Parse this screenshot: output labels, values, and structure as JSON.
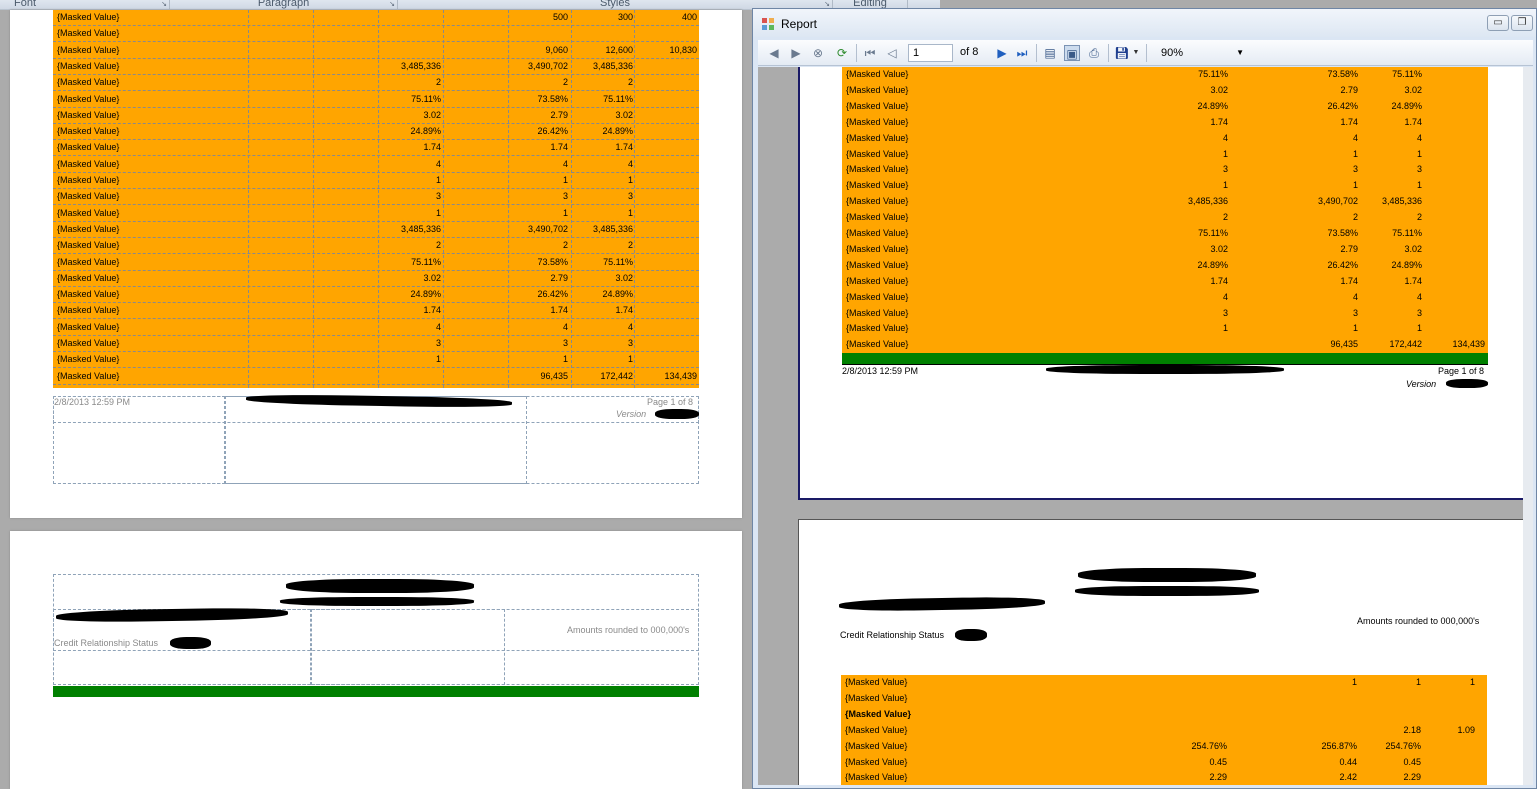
{
  "ribbon": {
    "groups": [
      "Font",
      "Paragraph",
      "Styles",
      "Editing"
    ]
  },
  "doc_page1": {
    "rows": [
      {
        "label": "{Masked Value}",
        "c1": "",
        "c2": "500",
        "c3": "300",
        "c4": "400"
      },
      {
        "label": "{Masked Value}",
        "c1": "",
        "c2": "",
        "c3": "",
        "c4": ""
      },
      {
        "label": "{Masked Value}",
        "c1": "",
        "c2": "9,060",
        "c3": "12,600",
        "c4": "10,830"
      },
      {
        "label": "{Masked Value}",
        "c1": "3,485,336",
        "c2": "3,490,702",
        "c3": "3,485,336",
        "c4": ""
      },
      {
        "label": "{Masked Value}",
        "c1": "2",
        "c2": "2",
        "c3": "2",
        "c4": ""
      },
      {
        "label": "{Masked Value}",
        "c1": "75.11%",
        "c2": "73.58%",
        "c3": "75.11%",
        "c4": ""
      },
      {
        "label": "{Masked Value}",
        "c1": "3.02",
        "c2": "2.79",
        "c3": "3.02",
        "c4": ""
      },
      {
        "label": "{Masked Value}",
        "c1": "24.89%",
        "c2": "26.42%",
        "c3": "24.89%",
        "c4": ""
      },
      {
        "label": "{Masked Value}",
        "c1": "1.74",
        "c2": "1.74",
        "c3": "1.74",
        "c4": ""
      },
      {
        "label": "{Masked Value}",
        "c1": "4",
        "c2": "4",
        "c3": "4",
        "c4": ""
      },
      {
        "label": "{Masked Value}",
        "c1": "1",
        "c2": "1",
        "c3": "1",
        "c4": ""
      },
      {
        "label": "{Masked Value}",
        "c1": "3",
        "c2": "3",
        "c3": "3",
        "c4": ""
      },
      {
        "label": "{Masked Value}",
        "c1": "1",
        "c2": "1",
        "c3": "1",
        "c4": ""
      },
      {
        "label": "{Masked Value}",
        "c1": "3,485,336",
        "c2": "3,490,702",
        "c3": "3,485,336",
        "c4": ""
      },
      {
        "label": "{Masked Value}",
        "c1": "2",
        "c2": "2",
        "c3": "2",
        "c4": ""
      },
      {
        "label": "{Masked Value}",
        "c1": "75.11%",
        "c2": "73.58%",
        "c3": "75.11%",
        "c4": ""
      },
      {
        "label": "{Masked Value}",
        "c1": "3.02",
        "c2": "2.79",
        "c3": "3.02",
        "c4": ""
      },
      {
        "label": "{Masked Value}",
        "c1": "24.89%",
        "c2": "26.42%",
        "c3": "24.89%",
        "c4": ""
      },
      {
        "label": "{Masked Value}",
        "c1": "1.74",
        "c2": "1.74",
        "c3": "1.74",
        "c4": ""
      },
      {
        "label": "{Masked Value}",
        "c1": "4",
        "c2": "4",
        "c3": "4",
        "c4": ""
      },
      {
        "label": "{Masked Value}",
        "c1": "3",
        "c2": "3",
        "c3": "3",
        "c4": ""
      },
      {
        "label": "{Masked Value}",
        "c1": "1",
        "c2": "1",
        "c3": "1",
        "c4": ""
      },
      {
        "label": "{Masked Value}",
        "c1": "",
        "c2": "96,435",
        "c3": "172,442",
        "c4": "134,439"
      }
    ],
    "footer_timestamp": "2/8/2013 12:59 PM",
    "footer_page": "Page 1 of 8",
    "footer_version": "Version"
  },
  "doc_page2": {
    "amounts_note": "Amounts rounded to 000,000's",
    "credit_status_label": "Credit Relationship Status"
  },
  "viewer": {
    "title": "Report",
    "current_page": "1",
    "of_label": "of",
    "total_pages": "8",
    "zoom": "90%",
    "page1_rows": [
      {
        "label": "{Masked Value}",
        "c1": "75.11%",
        "c2": "73.58%",
        "c3": "75.11%",
        "c4": ""
      },
      {
        "label": "{Masked Value}",
        "c1": "3.02",
        "c2": "2.79",
        "c3": "3.02",
        "c4": ""
      },
      {
        "label": "{Masked Value}",
        "c1": "24.89%",
        "c2": "26.42%",
        "c3": "24.89%",
        "c4": ""
      },
      {
        "label": "{Masked Value}",
        "c1": "1.74",
        "c2": "1.74",
        "c3": "1.74",
        "c4": ""
      },
      {
        "label": "{Masked Value}",
        "c1": "4",
        "c2": "4",
        "c3": "4",
        "c4": ""
      },
      {
        "label": "{Masked Value}",
        "c1": "1",
        "c2": "1",
        "c3": "1",
        "c4": ""
      },
      {
        "label": "{Masked Value}",
        "c1": "3",
        "c2": "3",
        "c3": "3",
        "c4": ""
      },
      {
        "label": "{Masked Value}",
        "c1": "1",
        "c2": "1",
        "c3": "1",
        "c4": ""
      },
      {
        "label": "{Masked Value}",
        "c1": "3,485,336",
        "c2": "3,490,702",
        "c3": "3,485,336",
        "c4": ""
      },
      {
        "label": "{Masked Value}",
        "c1": "2",
        "c2": "2",
        "c3": "2",
        "c4": ""
      },
      {
        "label": "{Masked Value}",
        "c1": "75.11%",
        "c2": "73.58%",
        "c3": "75.11%",
        "c4": ""
      },
      {
        "label": "{Masked Value}",
        "c1": "3.02",
        "c2": "2.79",
        "c3": "3.02",
        "c4": ""
      },
      {
        "label": "{Masked Value}",
        "c1": "24.89%",
        "c2": "26.42%",
        "c3": "24.89%",
        "c4": ""
      },
      {
        "label": "{Masked Value}",
        "c1": "1.74",
        "c2": "1.74",
        "c3": "1.74",
        "c4": ""
      },
      {
        "label": "{Masked Value}",
        "c1": "4",
        "c2": "4",
        "c3": "4",
        "c4": ""
      },
      {
        "label": "{Masked Value}",
        "c1": "3",
        "c2": "3",
        "c3": "3",
        "c4": ""
      },
      {
        "label": "{Masked Value}",
        "c1": "1",
        "c2": "1",
        "c3": "1",
        "c4": ""
      },
      {
        "label": "{Masked Value}",
        "c1": "",
        "c2": "96,435",
        "c3": "172,442",
        "c4": "134,439"
      }
    ],
    "page1_footer_timestamp": "2/8/2013 12:59 PM",
    "page1_footer_page": "Page 1 of 8",
    "page1_footer_version": "Version",
    "page2_amounts_note": "Amounts rounded to 000,000's",
    "page2_credit_status_label": "Credit Relationship Status",
    "page2_rows": [
      {
        "label": "{Masked Value}",
        "bold": false,
        "c1": "",
        "c2": "1",
        "c3": "1",
        "c4": "1"
      },
      {
        "label": "{Masked Value}",
        "bold": false,
        "c1": "",
        "c2": "",
        "c3": "",
        "c4": ""
      },
      {
        "label": "{Masked Value}",
        "bold": true,
        "c1": "",
        "c2": "",
        "c3": "",
        "c4": ""
      },
      {
        "label": "{Masked Value}",
        "bold": false,
        "c1": "",
        "c2": "",
        "c3": "2.18",
        "c4": "1.09"
      },
      {
        "label": "{Masked Value}",
        "bold": false,
        "c1": "254.76%",
        "c2": "256.87%",
        "c3": "254.76%",
        "c4": ""
      },
      {
        "label": "{Masked Value}",
        "bold": false,
        "c1": "0.45",
        "c2": "0.44",
        "c3": "0.45",
        "c4": ""
      },
      {
        "label": "{Masked Value}",
        "bold": false,
        "c1": "2.29",
        "c2": "2.42",
        "c3": "2.29",
        "c4": ""
      }
    ]
  },
  "colors": {
    "table_fill": "#ffa500",
    "total_bar": "#008000"
  }
}
